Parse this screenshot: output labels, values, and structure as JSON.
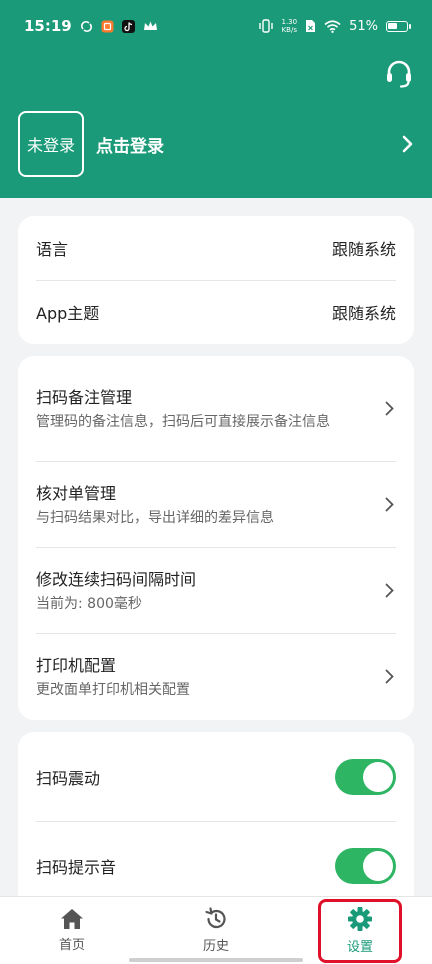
{
  "status_bar": {
    "time": "15:19",
    "net_speed_value": "1.30",
    "net_speed_unit": "KB/s",
    "battery": "51%",
    "battery_level": 0.51
  },
  "header": {
    "avatar_label": "未登录",
    "login_label": "点击登录",
    "support_icon": "headset-icon"
  },
  "settings": {
    "language": {
      "title": "语言",
      "value": "跟随系统"
    },
    "theme": {
      "title": "App主题",
      "value": "跟随系统"
    }
  },
  "manage": {
    "scan_notes": {
      "title": "扫码备注管理",
      "subtitle": "管理码的备注信息，扫码后可直接展示备注信息"
    },
    "check_list": {
      "title": "核对单管理",
      "subtitle": "与扫码结果对比，导出详细的差异信息"
    },
    "interval": {
      "title": "修改连续扫码间隔时间",
      "subtitle": "当前为: 800毫秒"
    },
    "printer": {
      "title": "打印机配置",
      "subtitle": "更改面单打印机相关配置"
    }
  },
  "toggles": {
    "vibrate": {
      "title": "扫码震动",
      "on": true
    },
    "sound": {
      "title": "扫码提示音",
      "on": true
    }
  },
  "nav": {
    "home": "首页",
    "history": "历史",
    "settings": "设置"
  },
  "colors": {
    "brand": "#1a9a78",
    "toggle_on": "#2eb563",
    "highlight": "#e0102a"
  }
}
